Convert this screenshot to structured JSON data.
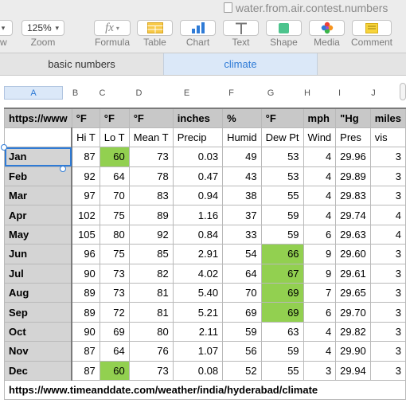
{
  "window": {
    "title": "water.from.air.contest.numbers"
  },
  "toolbar": {
    "zoom_value": "125%",
    "zoom_label": "Zoom",
    "view_label": "w",
    "formula_label": "Formula",
    "table_label": "Table",
    "chart_label": "Chart",
    "text_label": "Text",
    "shape_label": "Shape",
    "media_label": "Media",
    "comment_label": "Comment"
  },
  "tabs": [
    {
      "label": "basic numbers",
      "active": false
    },
    {
      "label": "climate",
      "active": true
    }
  ],
  "columns": [
    "A",
    "B",
    "C",
    "D",
    "E",
    "F",
    "G",
    "H",
    "I",
    "J"
  ],
  "table": {
    "source_url": "https://www.timeanddate.com/weather/india/hyderabad/climate",
    "units_row": [
      "https://www",
      "°F",
      "°F",
      "°F",
      "inches",
      "%",
      "°F",
      "mph",
      "\"Hg",
      "miles"
    ],
    "label_row": [
      "",
      "Hi T",
      "Lo T",
      "Mean T",
      "Precip",
      "Humid",
      "Dew Pt",
      "Wind",
      "Pres",
      "vis"
    ],
    "rows": [
      {
        "month": "Jan",
        "values": [
          "87",
          "60",
          "73",
          "0.03",
          "49",
          "53",
          "4",
          "29.96",
          "3"
        ]
      },
      {
        "month": "Feb",
        "values": [
          "92",
          "64",
          "78",
          "0.47",
          "43",
          "53",
          "4",
          "29.89",
          "3"
        ]
      },
      {
        "month": "Mar",
        "values": [
          "97",
          "70",
          "83",
          "0.94",
          "38",
          "55",
          "4",
          "29.83",
          "3"
        ]
      },
      {
        "month": "Apr",
        "values": [
          "102",
          "75",
          "89",
          "1.16",
          "37",
          "59",
          "4",
          "29.74",
          "4"
        ]
      },
      {
        "month": "May",
        "values": [
          "105",
          "80",
          "92",
          "0.84",
          "33",
          "59",
          "6",
          "29.63",
          "4"
        ]
      },
      {
        "month": "Jun",
        "values": [
          "96",
          "75",
          "85",
          "2.91",
          "54",
          "66",
          "9",
          "29.60",
          "3"
        ]
      },
      {
        "month": "Jul",
        "values": [
          "90",
          "73",
          "82",
          "4.02",
          "64",
          "67",
          "9",
          "29.61",
          "3"
        ]
      },
      {
        "month": "Aug",
        "values": [
          "89",
          "73",
          "81",
          "5.40",
          "70",
          "69",
          "7",
          "29.65",
          "3"
        ]
      },
      {
        "month": "Sep",
        "values": [
          "89",
          "72",
          "81",
          "5.21",
          "69",
          "69",
          "6",
          "29.70",
          "3"
        ]
      },
      {
        "month": "Oct",
        "values": [
          "90",
          "69",
          "80",
          "2.11",
          "59",
          "63",
          "4",
          "29.82",
          "3"
        ]
      },
      {
        "month": "Nov",
        "values": [
          "87",
          "64",
          "76",
          "1.07",
          "56",
          "59",
          "4",
          "29.90",
          "3"
        ]
      },
      {
        "month": "Dec",
        "values": [
          "87",
          "60",
          "73",
          "0.08",
          "52",
          "55",
          "3",
          "29.94",
          "3"
        ]
      }
    ],
    "highlight_color": "#92d050",
    "highlights": [
      {
        "month": "Jan",
        "column": "Lo T"
      },
      {
        "month": "Dec",
        "column": "Lo T"
      },
      {
        "month": "Jun",
        "column": "Dew Pt"
      },
      {
        "month": "Jul",
        "column": "Dew Pt"
      },
      {
        "month": "Aug",
        "column": "Dew Pt"
      },
      {
        "month": "Sep",
        "column": "Dew Pt"
      }
    ],
    "selected_cell": "Jan"
  },
  "colors": {
    "accent_blue": "#2f7bd6",
    "active_tab_bg": "#dbe8f8",
    "header_gray": "#c8c8c8"
  },
  "icons": [
    "document-icon",
    "formula-icon",
    "table-icon",
    "chart-icon",
    "text-icon",
    "shape-icon",
    "media-icon",
    "comment-icon",
    "chevron-down-icon"
  ]
}
